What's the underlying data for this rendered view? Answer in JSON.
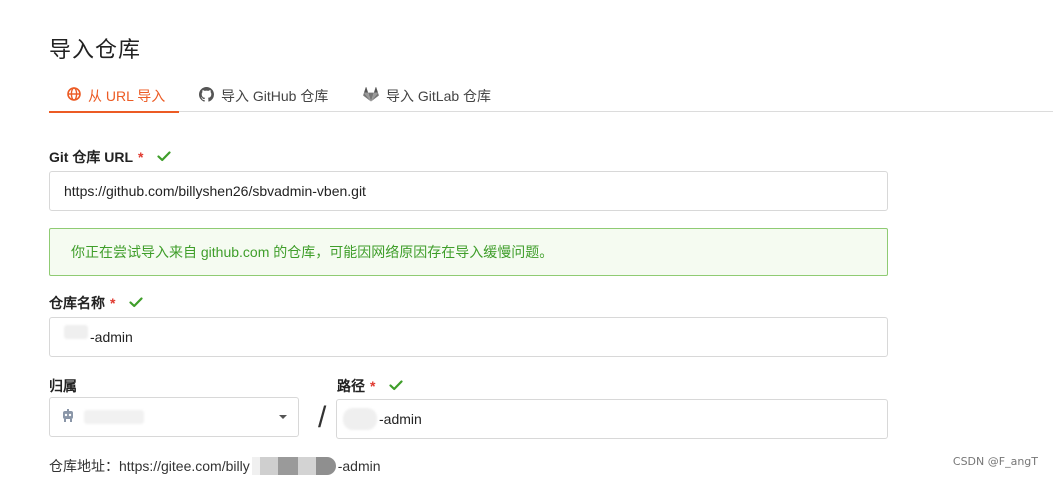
{
  "page": {
    "title": "导入仓库"
  },
  "tabs": [
    {
      "label": "从 URL 导入",
      "icon": "globe-icon",
      "active": true
    },
    {
      "label": "导入 GitHub 仓库",
      "icon": "github-icon",
      "active": false
    },
    {
      "label": "导入 GitLab 仓库",
      "icon": "gitlab-icon",
      "active": false
    }
  ],
  "form": {
    "git_url": {
      "label": "Git 仓库 URL",
      "required_mark": "*",
      "value": "https://github.com/billyshen26/sbvadmin-vben.git",
      "valid": true
    },
    "notice": "你正在尝试导入来自 github.com 的仓库，可能因网络原因存在导入缓慢问题。",
    "repo_name": {
      "label": "仓库名称",
      "required_mark": "*",
      "value": "-admin",
      "valid": true
    },
    "owner": {
      "label": "归属",
      "value": "",
      "icon": "user-avatar-icon"
    },
    "separator": "/",
    "path": {
      "label": "路径",
      "required_mark": "*",
      "value": "-admin",
      "valid": true
    },
    "repo_address": {
      "prefix": "仓库地址：https://gitee.com/billy",
      "suffix": "-admin"
    }
  },
  "watermark": "CSDN @F_angT",
  "colors": {
    "accent": "#ec5b24",
    "success": "#3f9e2a",
    "notice_border": "#8fcb73",
    "notice_bg": "#f5fbf1",
    "required": "#e0392f"
  }
}
